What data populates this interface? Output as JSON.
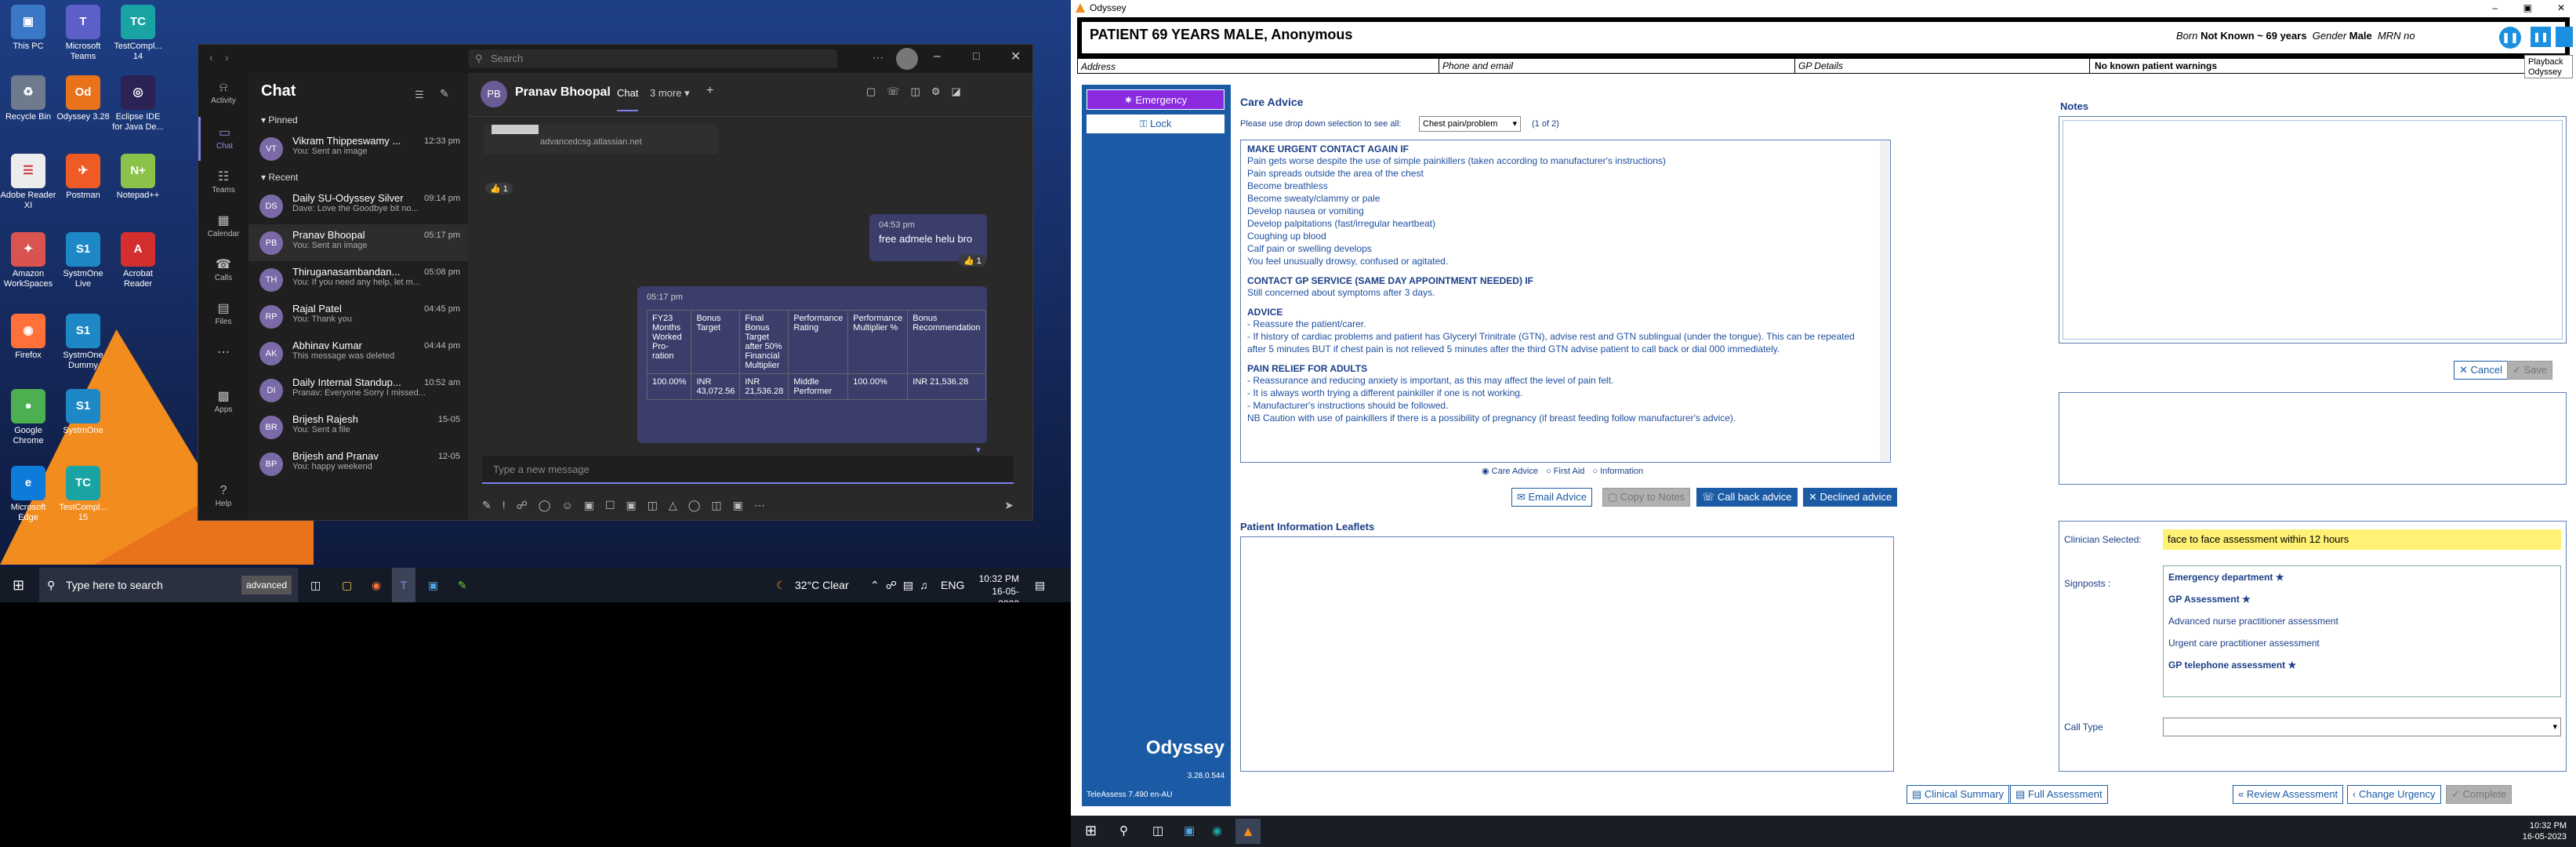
{
  "desktop": {
    "icons": [
      {
        "label": "This PC",
        "color": "#3a78c5",
        "glyph": "▣"
      },
      {
        "label": "Microsoft Teams",
        "color": "#5b5fc7",
        "glyph": "T"
      },
      {
        "label": "TestCompl... 14",
        "color": "#1aa3a3",
        "glyph": "TC"
      },
      {
        "label": "Recycle Bin",
        "color": "#6d7b8d",
        "glyph": "♻"
      },
      {
        "label": "Odyssey 3.28",
        "color": "#e8731a",
        "glyph": "Od"
      },
      {
        "label": "Eclipse IDE for Java De...",
        "color": "#2c2255",
        "glyph": "◎"
      },
      {
        "label": "Adobe Reader XI",
        "color": "#ececec",
        "glyph": "☰"
      },
      {
        "label": "Postman",
        "color": "#ef5b25",
        "glyph": "✈"
      },
      {
        "label": "Notepad++",
        "color": "#8bc34a",
        "glyph": "N+"
      },
      {
        "label": "Amazon WorkSpaces",
        "color": "#d9534f",
        "glyph": "✦"
      },
      {
        "label": "SystmOne Live",
        "color": "#1e88c7",
        "glyph": "S1"
      },
      {
        "label": "Acrobat Reader",
        "color": "#d32f2f",
        "glyph": "A"
      },
      {
        "label": "Firefox",
        "color": "#ff7139",
        "glyph": "◉"
      },
      {
        "label": "SystmOne Dummy",
        "color": "#1e88c7",
        "glyph": "S1"
      },
      {
        "label": "Google Chrome",
        "color": "#4caf50",
        "glyph": "●"
      },
      {
        "label": "SystmOne",
        "color": "#1e88c7",
        "glyph": "S1"
      },
      {
        "label": "Microsoft Edge",
        "color": "#0f7bd8",
        "glyph": "e"
      },
      {
        "label": "TestCompl... 15",
        "color": "#1aa3a3",
        "glyph": "TC"
      }
    ]
  },
  "teams": {
    "search_placeholder": "Search",
    "rail": [
      {
        "label": "Activity",
        "icon": "bell-icon",
        "glyph": "⍾"
      },
      {
        "label": "Chat",
        "icon": "chat-icon",
        "glyph": "▭"
      },
      {
        "label": "Teams",
        "icon": "teams-icon",
        "glyph": "☷"
      },
      {
        "label": "Calendar",
        "icon": "calendar-icon",
        "glyph": "▦"
      },
      {
        "label": "Calls",
        "icon": "phone-icon",
        "glyph": "☎"
      },
      {
        "label": "Files",
        "icon": "file-icon",
        "glyph": "▤"
      },
      {
        "label": "",
        "icon": "more-icon",
        "glyph": "⋯"
      },
      {
        "label": "Apps",
        "icon": "apps-icon",
        "glyph": "▩"
      }
    ],
    "rail_help": "Help",
    "list_title": "Chat",
    "pinned_label": "Pinned",
    "recent_label": "Recent",
    "pinned": [
      {
        "name": "Vikram Thippeswamy ...",
        "preview": "You: Sent an image",
        "time": "12:33 pm",
        "initials": "VT"
      }
    ],
    "recent": [
      {
        "name": "Daily SU-Odyssey Silver",
        "preview": "Dave: Love the Goodbye bit no...",
        "time": "09:14 pm",
        "initials": "DS"
      },
      {
        "name": "Pranav Bhoopal",
        "preview": "You: Sent an image",
        "time": "05:17 pm",
        "initials": "PB"
      },
      {
        "name": "Thiruganasambandan...",
        "preview": "You: If you need any help, let m...",
        "time": "05:08 pm",
        "initials": "TH"
      },
      {
        "name": "Rajal Patel",
        "preview": "You: Thank you",
        "time": "04:45 pm",
        "initials": "RP"
      },
      {
        "name": "Abhinav Kumar",
        "preview": "This message was deleted",
        "time": "04:44 pm",
        "initials": "AK"
      },
      {
        "name": "Daily Internal Standup...",
        "preview": "Pranav: Everyone Sorry I missed...",
        "time": "10:52 am",
        "initials": "DI"
      },
      {
        "name": "Brijesh Rajesh",
        "preview": "You: Sent a file",
        "time": "15-05",
        "initials": "BR"
      },
      {
        "name": "Brijesh and Pranav",
        "preview": "You: happy weekend",
        "time": "12-05",
        "initials": "BP"
      }
    ],
    "conv_initials": "PB",
    "conv_name": "Pranav Bhoopal",
    "conv_tab": "Chat",
    "conv_more": "3 more",
    "link_text": "advancedcsg.atlassian.net",
    "reaction1": "👍 1",
    "msg1_time": "04:53 pm",
    "msg1_text": "free admele helu bro",
    "reaction2": "👍 1",
    "msg2_time": "05:17 pm",
    "table_headers": [
      "FY23 Months Worked Pro-ration",
      "Bonus Target",
      "Final Bonus Target after 50% Financial Multiplier",
      "Performance Rating",
      "Performance Multiplier %",
      "Bonus Recommendation"
    ],
    "table_row": [
      "100.00%",
      "INR 43,072.56",
      "INR 21,536.28",
      "Middle Performer",
      "100.00%",
      "INR 21,536.28"
    ],
    "compose_placeholder": "Type a new message"
  },
  "taskbar": {
    "search_placeholder": "Type here to search",
    "search_badge": "advanced",
    "weather": "32°C  Clear",
    "lang": "ENG",
    "time": "10:32 PM",
    "date": "16-05-2023"
  },
  "odyssey": {
    "window_title": "Odyssey",
    "patient_title": "PATIENT 69 YEARS MALE, Anonymous",
    "born_label": "Born",
    "born_value": "Not Known ~ 69 years",
    "gender_label": "Gender",
    "gender_value": "Male",
    "mrn_label": "MRN no",
    "tooltip_line1": "Playback",
    "tooltip_line2": "Odyssey",
    "address_label": "Address",
    "phone_label": "Phone and email",
    "gp_label": "GP Details",
    "warnings": "No known patient warnings",
    "emergency_label": "Emergency",
    "lock_label": "Lock",
    "brand": "Odyssey",
    "version": "3.28.0.544",
    "teleassess": "TeleAssess 7.490 en-AU",
    "care_title": "Care Advice",
    "dropdown_prompt": "Please use drop down selection to see all:",
    "dropdown_value": "Chest pain/problem",
    "page_of": "(1 of 2)",
    "care_sections": [
      {
        "heading": "MAKE URGENT CONTACT AGAIN IF",
        "lines": [
          "Pain gets worse despite the use of simple painkillers (taken according to manufacturer's instructions)",
          "Pain spreads outside the area of the chest",
          "Become breathless",
          "Become sweaty/clammy or pale",
          "Develop nausea or vomiting",
          "Develop palpitations (fast/irregular heartbeat)",
          "Coughing up blood",
          "Calf pain or swelling develops",
          "You feel unusually drowsy, confused or agitated."
        ]
      },
      {
        "heading": "CONTACT GP SERVICE (SAME DAY APPOINTMENT NEEDED) IF",
        "lines": [
          "Still concerned about symptoms after 3 days."
        ]
      },
      {
        "heading": "ADVICE",
        "lines": [
          "- Reassure the patient/carer.",
          "- If history of cardiac problems and patient has Glyceryl Trinitrate (GTN), advise rest and GTN sublingual (under the tongue). This can be repeated after 5 minutes BUT if chest pain is not relieved 5 minutes after the third GTN advise patient to call back or dial 000 immediately."
        ]
      },
      {
        "heading": "PAIN RELIEF FOR ADULTS",
        "lines": [
          "- Reassurance and reducing anxiety is important, as this may affect the level of pain felt.",
          "- It is always worth trying a different painkiller if one is not working.",
          "- Manufacturer's instructions should be followed.",
          "NB Caution with use of painkillers if there is a possibility of pregnancy (if breast feeding follow manufacturer's advice)."
        ]
      }
    ],
    "radios": [
      "Care Advice",
      "First Aid",
      "Information"
    ],
    "btn_email": "Email Advice",
    "btn_copy": "Copy to Notes",
    "btn_callback": "Call back advice",
    "btn_declined": "Declined advice",
    "notes_title": "Notes",
    "btn_cancel": "Cancel",
    "btn_save": "Save",
    "pil_title": "Patient Information Leaflets",
    "clinician_label": "Clinician Selected:",
    "clinician_value": "face to face assessment within 12 hours",
    "signposts_label": "Signposts :",
    "signposts": [
      {
        "text": "Emergency department",
        "starred": true
      },
      {
        "text": "GP Assessment",
        "starred": true
      },
      {
        "text": "Advanced nurse practitioner assessment",
        "starred": false
      },
      {
        "text": "Urgent care practitioner assessment",
        "starred": false
      },
      {
        "text": "GP telephone assessment",
        "starred": true
      }
    ],
    "calltype_label": "Call Type",
    "btn_clinical": "Clinical Summary",
    "btn_full": "Full Assessment",
    "btn_review": "Review Assessment",
    "btn_urgency": "Change Urgency",
    "btn_complete": "Complete",
    "tb_time": "10:32 PM",
    "tb_date": "16-05-2023"
  },
  "colors": {
    "accent": "#1b5ba6",
    "emergency": "#8a2be2",
    "clinician_highlight": "#fff176",
    "teams_accent": "#7b83eb"
  }
}
